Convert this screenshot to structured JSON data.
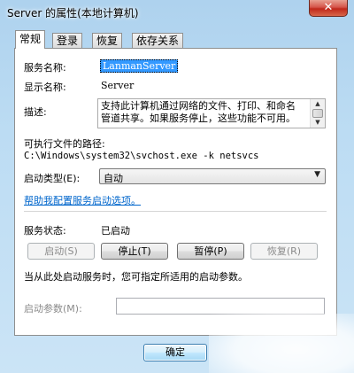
{
  "window": {
    "title": "Server 的属性(本地计算机)",
    "close_glyph": "✕"
  },
  "tabs": [
    {
      "label": "常规",
      "active": true
    },
    {
      "label": "登录",
      "active": false
    },
    {
      "label": "恢复",
      "active": false
    },
    {
      "label": "依存关系",
      "active": false
    }
  ],
  "general": {
    "service_name_label": "服务名称:",
    "service_name_value": "LanmanServer",
    "display_name_label": "显示名称:",
    "display_name_value": "Server",
    "description_label": "描述:",
    "description_value": "支持此计算机通过网络的文件、打印、和命名管道共享。如果服务停止，这些功能不可用。",
    "path_label": "可执行文件的路径:",
    "path_value": "C:\\Windows\\system32\\svchost.exe -k netsvcs",
    "startup_type_label": "启动类型(E):",
    "startup_type_value": "自动",
    "help_link": "帮助我配置服务启动选项。",
    "status_label": "服务状态:",
    "status_value": "已启动",
    "start_params_note": "当从此处启动服务时，您可指定所适用的启动参数。",
    "start_params_label": "启动参数(M):",
    "start_params_value": ""
  },
  "buttons": {
    "start": "启动(S)",
    "stop": "停止(T)",
    "pause": "暂停(P)",
    "resume": "恢复(R)",
    "ok": "确定"
  },
  "icons": {
    "dropdown": "chevron-down-icon",
    "scroll_up": "scroll-up-icon",
    "scroll_down": "scroll-down-icon",
    "close": "close-icon"
  }
}
